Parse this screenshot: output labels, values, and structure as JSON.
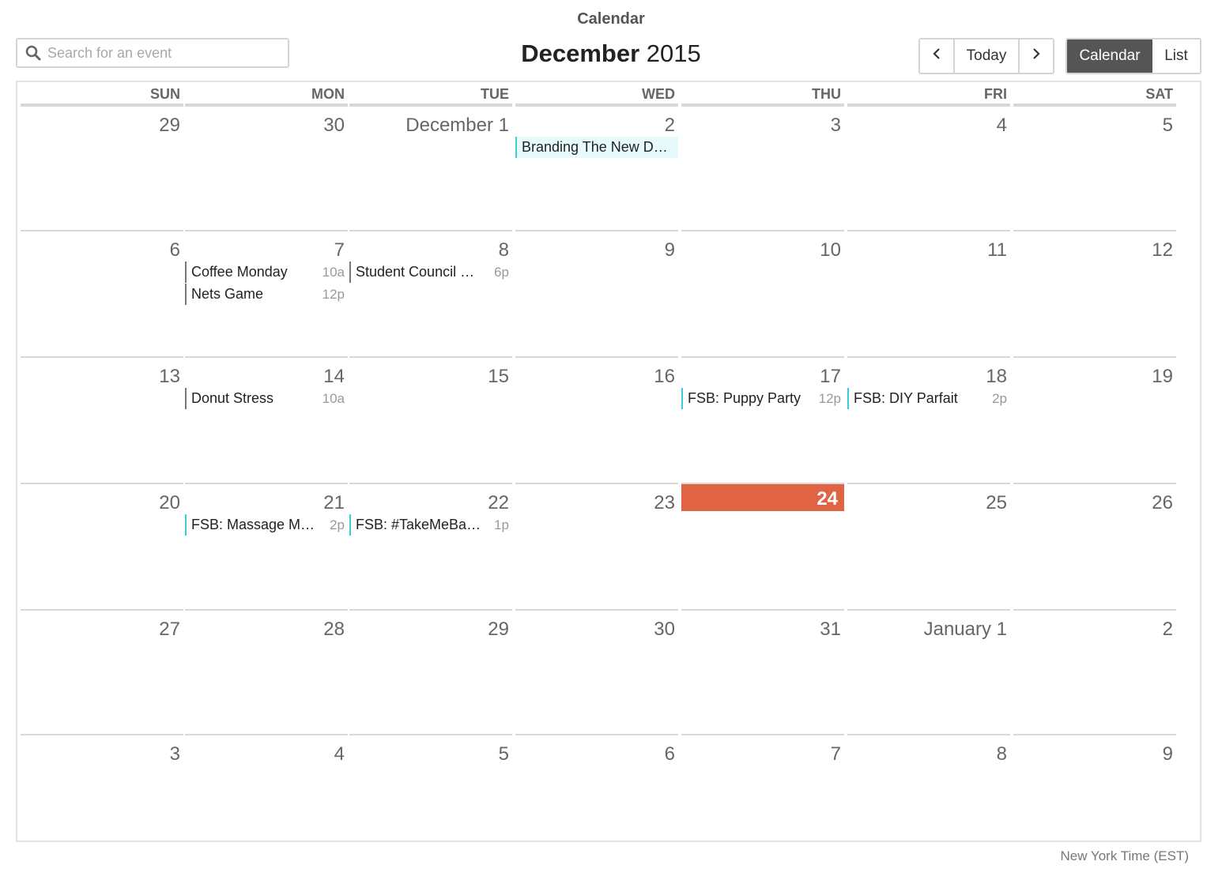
{
  "app": {
    "title": "Calendar"
  },
  "search": {
    "placeholder": "Search for an event",
    "value": ""
  },
  "header": {
    "month": "December",
    "year": "2015"
  },
  "nav": {
    "prev_icon": "chevron-left-icon",
    "today_label": "Today",
    "next_icon": "chevron-right-icon"
  },
  "views": {
    "calendar_label": "Calendar",
    "list_label": "List",
    "active": "Calendar"
  },
  "weekdays": [
    "SUN",
    "MON",
    "TUE",
    "WED",
    "THU",
    "FRI",
    "SAT"
  ],
  "colors": {
    "today": "#e06443",
    "event_accent": "#40c9d6",
    "event_default": "#777777",
    "active_view": "#555555"
  },
  "weeks": [
    [
      "29",
      "30",
      "December 1",
      "2",
      "3",
      "4",
      "5"
    ],
    [
      "6",
      "7",
      "8",
      "9",
      "10",
      "11",
      "12"
    ],
    [
      "13",
      "14",
      "15",
      "16",
      "17",
      "18",
      "19"
    ],
    [
      "20",
      "21",
      "22",
      "23",
      "24",
      "25",
      "26"
    ],
    [
      "27",
      "28",
      "29",
      "30",
      "31",
      "January 1",
      "2"
    ],
    [
      "3",
      "4",
      "5",
      "6",
      "7",
      "8",
      "9"
    ]
  ],
  "today": {
    "week": 3,
    "day": 4
  },
  "events": [
    {
      "week": 0,
      "day": 3,
      "slot": 0,
      "title": "Branding The New D…",
      "time": "",
      "style": "allday"
    },
    {
      "week": 1,
      "day": 1,
      "slot": 0,
      "title": "Coffee Monday",
      "time": "10a",
      "style": "default"
    },
    {
      "week": 1,
      "day": 1,
      "slot": 1,
      "title": "Nets Game",
      "time": "12p",
      "style": "default"
    },
    {
      "week": 1,
      "day": 2,
      "slot": 0,
      "title": "Student Council …",
      "time": "6p",
      "style": "default"
    },
    {
      "week": 2,
      "day": 1,
      "slot": 0,
      "title": "Donut Stress",
      "time": "10a",
      "style": "default"
    },
    {
      "week": 2,
      "day": 4,
      "slot": 0,
      "title": "FSB: Puppy Party",
      "time": "12p",
      "style": "accent"
    },
    {
      "week": 2,
      "day": 5,
      "slot": 0,
      "title": "FSB: DIY Parfait",
      "time": "2p",
      "style": "accent"
    },
    {
      "week": 3,
      "day": 1,
      "slot": 0,
      "title": "FSB: Massage M…",
      "time": "2p",
      "style": "accent"
    },
    {
      "week": 3,
      "day": 2,
      "slot": 0,
      "title": "FSB: #TakeMeBa…",
      "time": "1p",
      "style": "accent"
    }
  ],
  "footer": {
    "timezone": "New York Time (EST)"
  }
}
